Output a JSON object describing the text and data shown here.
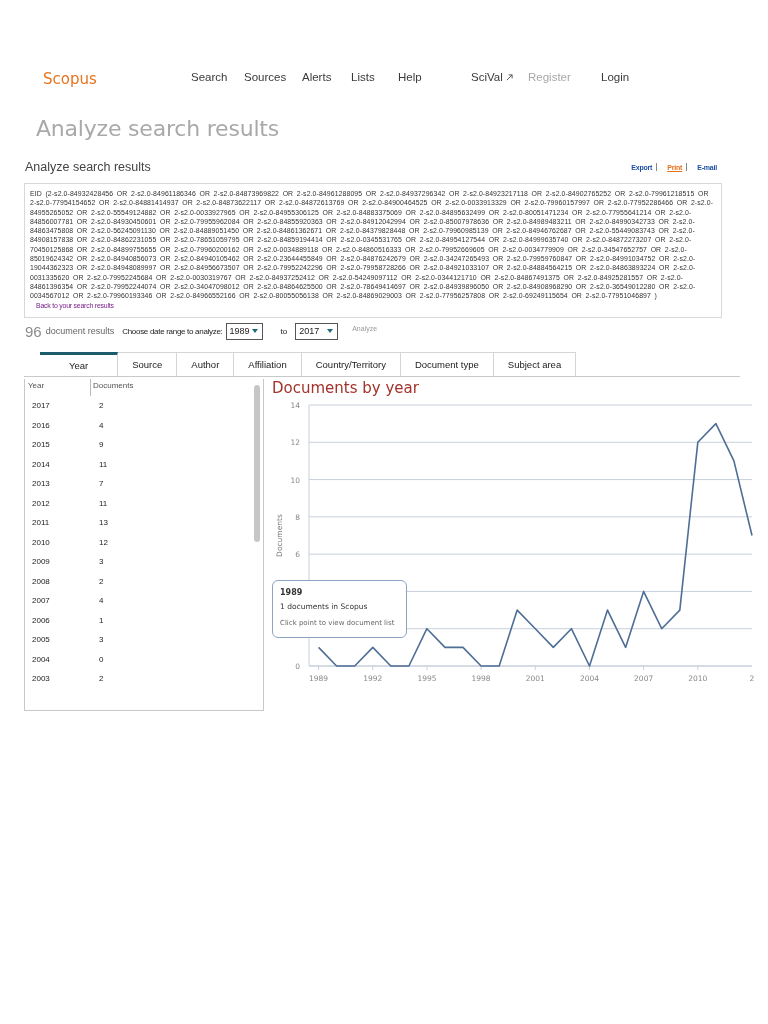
{
  "header": {
    "logo": "Scopus",
    "nav": [
      {
        "label": "Search",
        "external": false,
        "disabled": false
      },
      {
        "label": "Sources",
        "external": false,
        "disabled": false
      },
      {
        "label": "Alerts",
        "external": false,
        "disabled": false
      },
      {
        "label": "Lists",
        "external": false,
        "disabled": false
      },
      {
        "label": "Help",
        "external": false,
        "disabled": false
      },
      {
        "label": "SciVal",
        "external": true,
        "disabled": false
      },
      {
        "label": "Register",
        "external": false,
        "disabled": true
      },
      {
        "label": "Login",
        "external": false,
        "disabled": false
      }
    ]
  },
  "page_title": "Analyze search results",
  "section": {
    "title": "Analyze search results",
    "actions": [
      {
        "label": "Export",
        "hovered": false
      },
      {
        "label": "Print",
        "hovered": true
      },
      {
        "label": "E-mail",
        "hovered": false
      }
    ]
  },
  "query": {
    "text": "EID (2-s2.0-84932428456 OR 2-s2.0-84961186346 OR 2-s2.0-84873969822 OR 2-s2.0-84961288095 OR 2-s2.0-84937296342 OR 2-s2.0-84923217118 OR 2-s2.0-84902765252 OR 2-s2.0-79961218515 OR 2-s2.0-77954154652 OR 2-s2.0-84881414937 OR 2-s2.0-84873622117 OR 2-s2.0-84872613769 OR 2-s2.0-84900464525 OR 2-s2.0-0033913329 OR 2-s2.0-79960157997 OR 2-s2.0-77952286466 OR 2-s2.0-84955265052 OR 2-s2.0-55549124882 OR 2-s2.0-0033927965 OR 2-s2.0-84955306125 OR 2-s2.0-84883375069 OR 2-s2.0-84895632499 OR 2-s2.0-80051471234 OR 2-s2.0-77955641214 OR 2-s2.0-84856007781 OR 2-s2.0-84930450601 OR 2-s2.0-79955962084 OR 2-s2.0-84855920363 OR 2-s2.0-84912042994 OR 2-s2.0-85007978636 OR 2-s2.0-84989483211 OR 2-s2.0-84990342733 OR 2-s2.0-84863475808 OR 2-s2.0-56245091130 OR 2-s2.0-84889051450 OR 2-s2.0-84861362671 OR 2-s2.0-84379828448 OR 2-s2.0-79960985139 OR 2-s2.0-84946762687 OR 2-s2.0-55449083743 OR 2-s2.0-84908157838 OR 2-s2.0-84862231055 OR 2-s2.0-78651059795 OR 2-s2.0-84859194414 OR 2-s2.0-0345531765 OR 2-s2.0-84954127544 OR 2-s2.0-84999635740 OR 2-s2.0-84872273207 OR 2-s2.0-70450125868 OR 2-s2.0-84899755655 OR 2-s2.0-79960200162 OR 2-s2.0-0034889118 OR 2-s2.0-84860516333 OR 2-s2.0-79952669605 OR 2-s2.0-0034779909 OR 2-s2.0-34547652757 OR 2-s2.0-85019624342 OR 2-s2.0-84940856073 OR 2-s2.0-84940105462 OR 2-s2.0-23644455849 OR 2-s2.0-84876242679 OR 2-s2.0-34247265493 OR 2-s2.0-79959760847 OR 2-s2.0-84991034752 OR 2-s2.0-19044362323 OR 2-s2.0-84948089997 OR 2-s2.0-84956673507 OR 2-s2.0-79952242296 OR 2-s2.0-79958728266 OR 2-s2.0-84921033107 OR 2-s2.0-84884564215 OR 2-s2.0-84863893224 OR 2-s2.0-0031335620 OR 2-s2.0-79952245684 OR 2-s2.0-0030319767 OR 2-s2.0-84937252412 OR 2-s2.0-54249097112 OR 2-s2.0-0344121710 OR 2-s2.0-84867491375 OR 2-s2.0-84925281557 OR 2-s2.0-84861396354 OR 2-s2.0-79952244074 OR 2-s2.0-34047098012 OR 2-s2.0-84864625500 OR 2-s2.0-78649414697 OR 2-s2.0-84939896050 OR 2-s2.0-84908968290 OR 2-s2.0-36549012280 OR 2-s2.0-0034567012 OR 2-s2.0-79960193346 OR 2-s2.0-84966552166 OR 2-s2.0-80055056138 OR 2-s2.0-84869029003 OR 2-s2.0-77956257808 OR 2-s2.0-69249115654 OR 2-s2.0-77951046897 )",
    "link": "Back to your search results"
  },
  "controls": {
    "count": "96",
    "count_label": "document results",
    "range_label": "Choose date range to analyze:",
    "from": "1989",
    "to_label": "to",
    "to": "2017",
    "analyze": {
      "label": "Analyze",
      "disabled": true
    }
  },
  "tabs": [
    {
      "label": "Year",
      "selected": true
    },
    {
      "label": "Source",
      "selected": false
    },
    {
      "label": "Author",
      "selected": false
    },
    {
      "label": "Affiliation",
      "selected": false
    },
    {
      "label": "Country/Territory",
      "selected": false
    },
    {
      "label": "Document type",
      "selected": false
    },
    {
      "label": "Subject area",
      "selected": false
    }
  ],
  "table": {
    "columns": [
      "Year",
      "Documents"
    ],
    "rows": [
      [
        "2017",
        "2"
      ],
      [
        "2016",
        "4"
      ],
      [
        "2015",
        "9"
      ],
      [
        "2014",
        "11"
      ],
      [
        "2013",
        "7"
      ],
      [
        "2012",
        "11"
      ],
      [
        "2011",
        "13"
      ],
      [
        "2010",
        "12"
      ],
      [
        "2009",
        "3"
      ],
      [
        "2008",
        "2"
      ],
      [
        "2007",
        "4"
      ],
      [
        "2006",
        "1"
      ],
      [
        "2005",
        "3"
      ],
      [
        "2004",
        "0"
      ],
      [
        "2003",
        "2"
      ]
    ]
  },
  "chart": {
    "tooltip": {
      "title": "1989",
      "line": "1 documents in Scopus",
      "hint": "Click point to view document list"
    },
    "cut_tick_label": "2",
    "chart_data": {
      "type": "line",
      "title": "Documents by year",
      "ylabel": "Documents",
      "x": [
        1989,
        1990,
        1991,
        1992,
        1993,
        1994,
        1995,
        1996,
        1997,
        1998,
        1999,
        2000,
        2001,
        2002,
        2003,
        2004,
        2005,
        2006,
        2007,
        2008,
        2009,
        2010,
        2011,
        2012,
        2013
      ],
      "values": [
        1,
        0,
        0,
        1,
        0,
        0,
        2,
        1,
        1,
        0,
        0,
        3,
        2,
        1,
        2,
        0,
        3,
        1,
        4,
        2,
        3,
        12,
        13,
        11,
        7
      ],
      "xlim": [
        1988.47,
        2013
      ],
      "ylim": [
        0,
        14
      ],
      "xticks": [
        1989,
        1992,
        1995,
        1998,
        2001,
        2004,
        2007,
        2010
      ],
      "yticks": [
        0,
        6,
        8,
        10,
        12,
        14
      ],
      "grid": true
    }
  }
}
